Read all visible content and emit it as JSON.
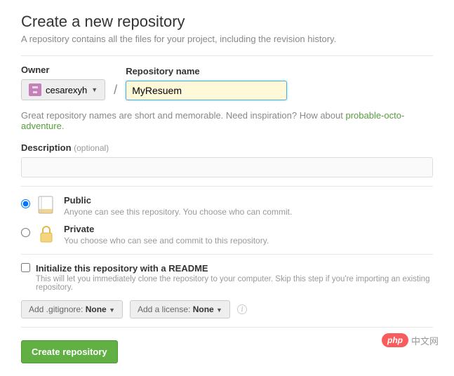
{
  "title": "Create a new repository",
  "subtitle": "A repository contains all the files for your project, including the revision history.",
  "owner": {
    "label": "Owner",
    "username": "cesarexyh"
  },
  "repo": {
    "label": "Repository name",
    "value": "MyResuem"
  },
  "hint": {
    "text_pre": "Great repository names are short and memorable. Need inspiration? How about ",
    "suggestion": "probable-octo-adventure",
    "text_post": "."
  },
  "description": {
    "label": "Description",
    "optional": "(optional)",
    "value": ""
  },
  "visibility": {
    "public": {
      "title": "Public",
      "sub": "Anyone can see this repository. You choose who can commit."
    },
    "private": {
      "title": "Private",
      "sub": "You choose who can see and commit to this repository."
    }
  },
  "readme": {
    "title": "Initialize this repository with a README",
    "sub": "This will let you immediately clone the repository to your computer. Skip this step if you're importing an existing repository."
  },
  "selectors": {
    "gitignore_pre": "Add .gitignore: ",
    "gitignore_val": "None",
    "license_pre": "Add a license: ",
    "license_val": "None"
  },
  "submit": "Create repository",
  "watermark": {
    "pill": "php",
    "text": "中文网"
  }
}
